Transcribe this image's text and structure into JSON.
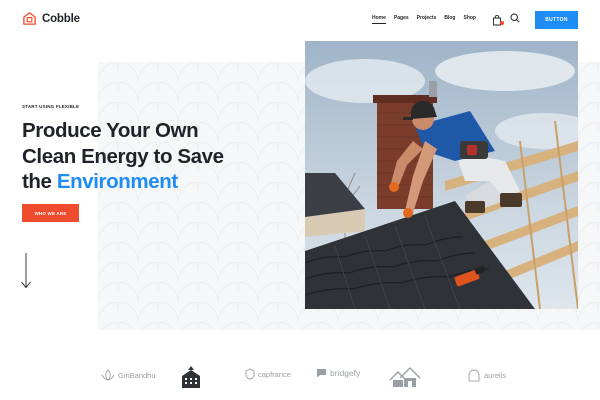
{
  "header": {
    "brand_name": "Cobble",
    "nav": [
      "Home",
      "Pages",
      "Projects",
      "Blog",
      "Shop"
    ],
    "active_nav_index": 0,
    "cta_label": "BUTTON"
  },
  "hero": {
    "eyebrow": "START USING FLEXIBLE",
    "headline_line1": "Produce Your Own",
    "headline_line2": "Clean Energy to Save",
    "headline_line3_plain": "the",
    "headline_line3_accent": "Environment",
    "primary_button": "WHO WE ARE"
  },
  "brands": [
    {
      "name": "GiriBandhu",
      "icon": "lotus-icon"
    },
    {
      "name": "",
      "icon": "building-icon"
    },
    {
      "name": "capfrance",
      "icon": "shield-icon"
    },
    {
      "name": "bridgefy",
      "icon": "chat-icon"
    },
    {
      "name": "",
      "icon": "houses-icon"
    },
    {
      "name": "aurelis",
      "icon": "arch-icon"
    }
  ],
  "colors": {
    "accent_blue": "#1f8bf5",
    "accent_red": "#ef4b2f",
    "text_dark": "#1f2329",
    "brand_gray": "#9aa0a6"
  }
}
